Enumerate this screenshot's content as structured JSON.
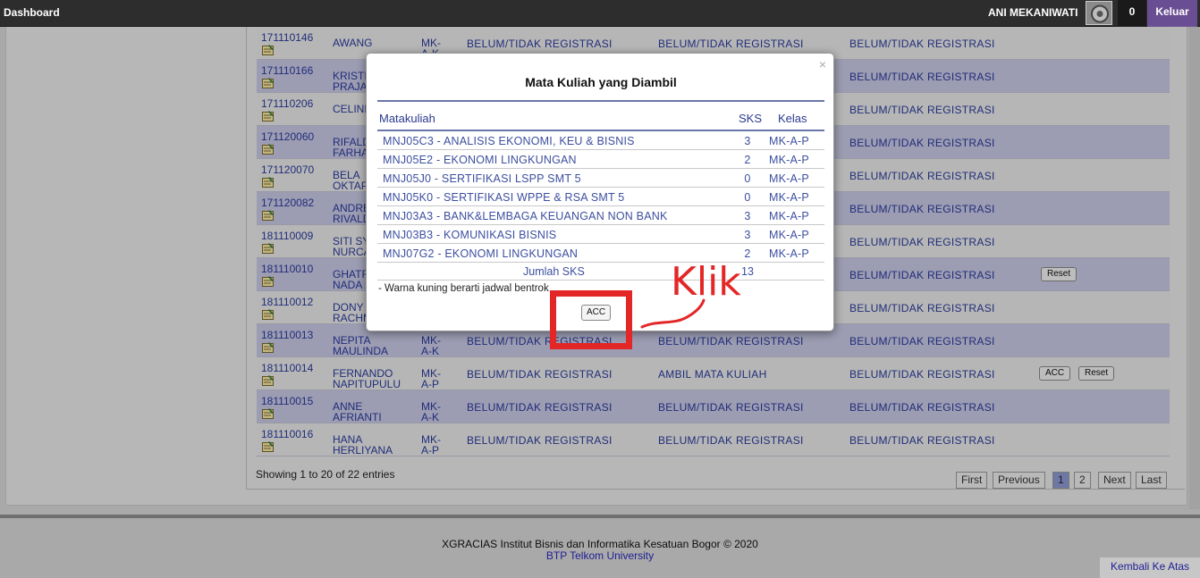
{
  "topbar": {
    "title": "Dashboard",
    "user": "ANI MEKANIWATI",
    "notif_count": "0",
    "logout": "Keluar"
  },
  "rows": [
    {
      "nim": "171110146",
      "name": "AWANG",
      "kelas": "MK-\nA-K",
      "s1": "BELUM/TIDAK REGISTRASI",
      "s2": "BELUM/TIDAK REGISTRASI",
      "s3": "BELUM/TIDAK REGISTRASI"
    },
    {
      "nim": "171110166",
      "name": "KRISTI\nPRAJA\nDARMA",
      "kelas": "",
      "s1": "",
      "s2": "",
      "s3": "BELUM/TIDAK REGISTRASI"
    },
    {
      "nim": "171110206",
      "name": "CELINE",
      "kelas": "",
      "s1": "",
      "s2": "",
      "s3": "BELUM/TIDAK REGISTRASI"
    },
    {
      "nim": "171120060",
      "name": "RIFALD\nFARHA",
      "kelas": "",
      "s1": "",
      "s2": "",
      "s3": "BELUM/TIDAK REGISTRASI"
    },
    {
      "nim": "171120070",
      "name": "BELA\nOKTAP",
      "kelas": "",
      "s1": "",
      "s2": "",
      "s3": "BELUM/TIDAK REGISTRASI"
    },
    {
      "nim": "171120082",
      "name": "ANDRE\nRIVALD",
      "kelas": "",
      "s1": "",
      "s2": "",
      "s3": "BELUM/TIDAK REGISTRASI"
    },
    {
      "nim": "181110009",
      "name": "SITI SY\nNURCA",
      "kelas": "",
      "s1": "",
      "s2": "",
      "s3": "BELUM/TIDAK REGISTRASI"
    },
    {
      "nim": "181110010",
      "name": "GHATR\nNADA",
      "kelas": "",
      "s1": "",
      "s2": "",
      "s3": "BELUM/TIDAK REGISTRASI",
      "reset": "Reset"
    },
    {
      "nim": "181110012",
      "name": "DONY\nRACHM",
      "kelas": "",
      "s1": "",
      "s2": "",
      "s3": "BELUM/TIDAK REGISTRASI"
    },
    {
      "nim": "181110013",
      "name": "NEPITA\nMAULINDA",
      "kelas": "MK-\nA-K",
      "s1": "BELUM/TIDAK REGISTRASI",
      "s2": "BELUM/TIDAK REGISTRASI",
      "s3": "BELUM/TIDAK REGISTRASI"
    },
    {
      "nim": "181110014",
      "name": "FERNANDO\nNAPITUPULU",
      "kelas": "MK-\nA-P",
      "s1": "BELUM/TIDAK REGISTRASI",
      "s2": "AMBIL MATA KULIAH",
      "s3": "BELUM/TIDAK REGISTRASI",
      "acc": "ACC",
      "reset": "Reset"
    },
    {
      "nim": "181110015",
      "name": "ANNE\nAFRIANTI",
      "kelas": "MK-\nA-K",
      "s1": "BELUM/TIDAK REGISTRASI",
      "s2": "BELUM/TIDAK REGISTRASI",
      "s3": "BELUM/TIDAK REGISTRASI"
    },
    {
      "nim": "181110016",
      "name": "HANA\nHERLIYANA",
      "kelas": "MK-\nA-P",
      "s1": "BELUM/TIDAK REGISTRASI",
      "s2": "BELUM/TIDAK REGISTRASI",
      "s3": "BELUM/TIDAK REGISTRASI"
    }
  ],
  "table_info": "Showing 1 to 20 of 22 entries",
  "pagination": {
    "first": "First",
    "previous": "Previous",
    "pages": [
      "1",
      "2"
    ],
    "next": "Next",
    "last": "Last"
  },
  "footer": {
    "text": "XGRACIAS Institut Bisnis dan Informatika Kesatuan Bogor © 2020",
    "link": "BTP Telkom University",
    "back_to_top": "Kembali Ke Atas"
  },
  "modal": {
    "close": "×",
    "title": "Mata Kuliah yang Diambil",
    "headers": {
      "matakuliah": "Matakuliah",
      "sks": "SKS",
      "kelas": "Kelas"
    },
    "rows": [
      {
        "mk": "MNJ05C3 - ANALISIS EKONOMI, KEU & BISNIS",
        "sks": "3",
        "kelas": "MK-A-P"
      },
      {
        "mk": "MNJ05E2 - EKONOMI LINGKUNGAN",
        "sks": "2",
        "kelas": "MK-A-P"
      },
      {
        "mk": "MNJ05J0 - SERTIFIKASI LSPP SMT 5",
        "sks": "0",
        "kelas": "MK-A-P"
      },
      {
        "mk": "MNJ05K0 - SERTIFIKASI WPPE & RSA SMT 5",
        "sks": "0",
        "kelas": "MK-A-P"
      },
      {
        "mk": "MNJ03A3 - BANK&LEMBAGA KEUANGAN NON BANK",
        "sks": "3",
        "kelas": "MK-A-P"
      },
      {
        "mk": "MNJ03B3 - KOMUNIKASI BISNIS",
        "sks": "3",
        "kelas": "MK-A-P"
      },
      {
        "mk": "MNJ07G2 - EKONOMI LINGKUNGAN",
        "sks": "2",
        "kelas": "MK-A-P"
      }
    ],
    "total_label": "Jumlah SKS",
    "total_value": "13",
    "note": "- Warna kuning berarti jadwal bentrok",
    "acc_button": "ACC"
  },
  "annotation": {
    "label": "Klik",
    "color": "#e32626"
  }
}
